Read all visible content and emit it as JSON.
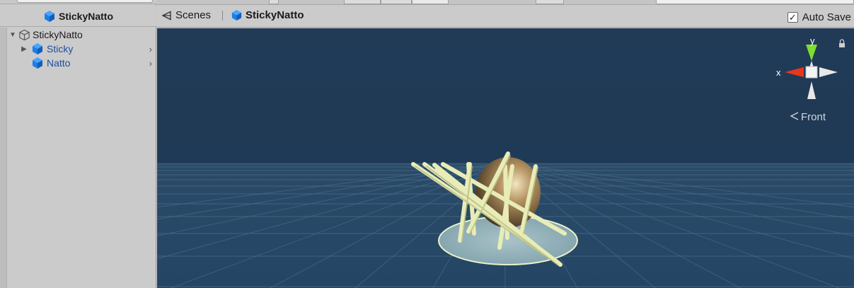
{
  "hierarchy": {
    "title": "StickyNatto",
    "items": [
      {
        "label": "StickyNatto",
        "color": "#1a1a1a"
      },
      {
        "label": "Sticky",
        "color": "#1d4f9c"
      },
      {
        "label": "Natto",
        "color": "#1d4f9c"
      }
    ]
  },
  "scene": {
    "scenes_label": "Scenes",
    "current_scene": "StickyNatto",
    "auto_save_label": "Auto Save",
    "auto_save_checked": "✓",
    "gizmo": {
      "y_label": "y",
      "x_label": "x",
      "view_label": "Front"
    }
  },
  "colors": {
    "accent_blue": "#1d7ee8",
    "prefab_text": "#1d4f9c",
    "viewport_bg": "#213a55",
    "gizmo_y": "#7fdd2f",
    "gizmo_x": "#e8371c"
  }
}
